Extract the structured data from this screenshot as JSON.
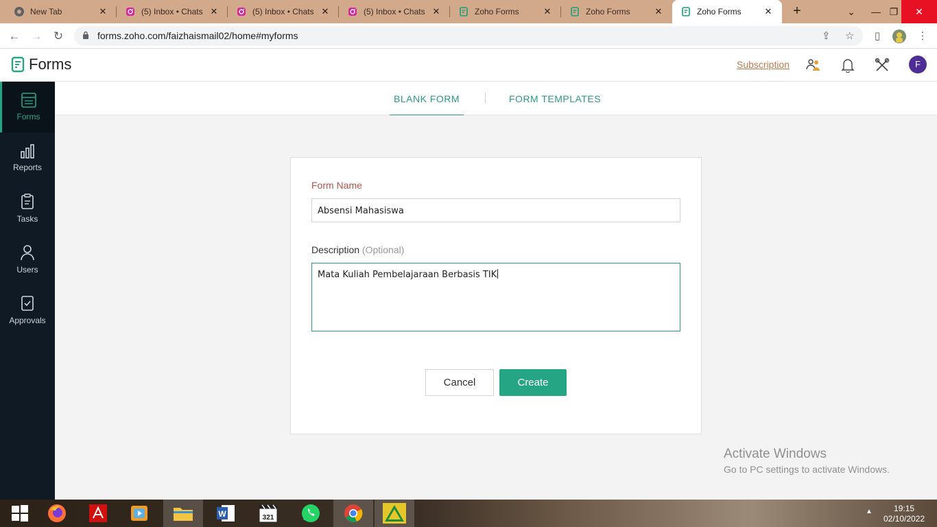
{
  "browser": {
    "tabs": [
      {
        "title": "New Tab",
        "icon": "chrome-icon"
      },
      {
        "title": "(5) Inbox • Chats",
        "icon": "instagram-icon"
      },
      {
        "title": "(5) Inbox • Chats",
        "icon": "instagram-icon"
      },
      {
        "title": "(5) Inbox • Chats",
        "icon": "instagram-icon"
      },
      {
        "title": "Zoho Forms",
        "icon": "zoho-forms-icon"
      },
      {
        "title": "Zoho Forms",
        "icon": "zoho-forms-icon"
      },
      {
        "title": "Zoho Forms",
        "icon": "zoho-forms-icon",
        "active": true
      }
    ],
    "url": "forms.zoho.com/faizhaismail02/home#myforms"
  },
  "app": {
    "name": "Forms",
    "subscription_label": "Subscription",
    "avatar_letter": "F",
    "accent": "#26a584"
  },
  "sidebar": {
    "items": [
      {
        "label": "Forms",
        "icon": "forms-icon",
        "active": true
      },
      {
        "label": "Reports",
        "icon": "bar-chart-icon"
      },
      {
        "label": "Tasks",
        "icon": "clipboard-icon"
      },
      {
        "label": "Users",
        "icon": "user-icon"
      },
      {
        "label": "Approvals",
        "icon": "approval-icon"
      }
    ]
  },
  "form_tabs": {
    "blank": "BLANK FORM",
    "templates": "FORM TEMPLATES"
  },
  "form": {
    "name_label": "Form Name",
    "name_value": "Absensi Mahasiswa",
    "description_label": "Description",
    "description_optional": "(Optional)",
    "description_value": "Mata Kuliah Pembelajaraan Berbasis TIK",
    "cancel_label": "Cancel",
    "create_label": "Create"
  },
  "watermark": {
    "line1": "Activate Windows",
    "line2": "Go to PC settings to activate Windows."
  },
  "taskbar": {
    "time": "19:15",
    "date": "02/10/2022"
  }
}
